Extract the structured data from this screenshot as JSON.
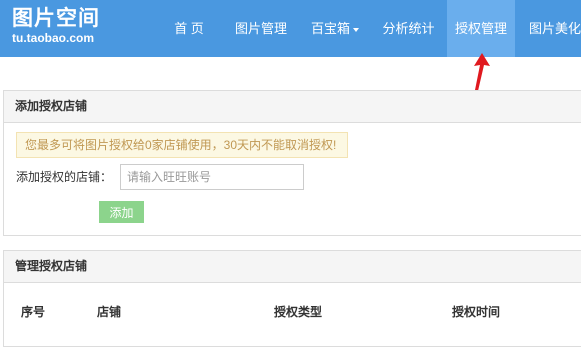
{
  "logo": {
    "title": "图片空间",
    "subtitle": "tu.taobao.com"
  },
  "nav": {
    "home": "首 页",
    "image_manage": "图片管理",
    "toolbox": "百宝箱",
    "analytics": "分析统计",
    "auth_manage": "授权管理",
    "image_beautify": "图片美化"
  },
  "add_panel": {
    "title": "添加授权店铺",
    "warning": "您最多可将图片授权给0家店铺使用，30天内不能取消授权!",
    "shop_label": "添加授权的店铺：",
    "input_placeholder": "请输入旺旺账号",
    "input_value": "",
    "add_button": "添加"
  },
  "manage_panel": {
    "title": "管理授权店铺",
    "columns": [
      "序号",
      "店铺",
      "授权类型",
      "授权时间"
    ]
  },
  "colors": {
    "topbar": "#4a98e0",
    "active_tab": "#6aaeed",
    "annotation_arrow": "#e0191f",
    "add_button": "#8cd48c"
  }
}
